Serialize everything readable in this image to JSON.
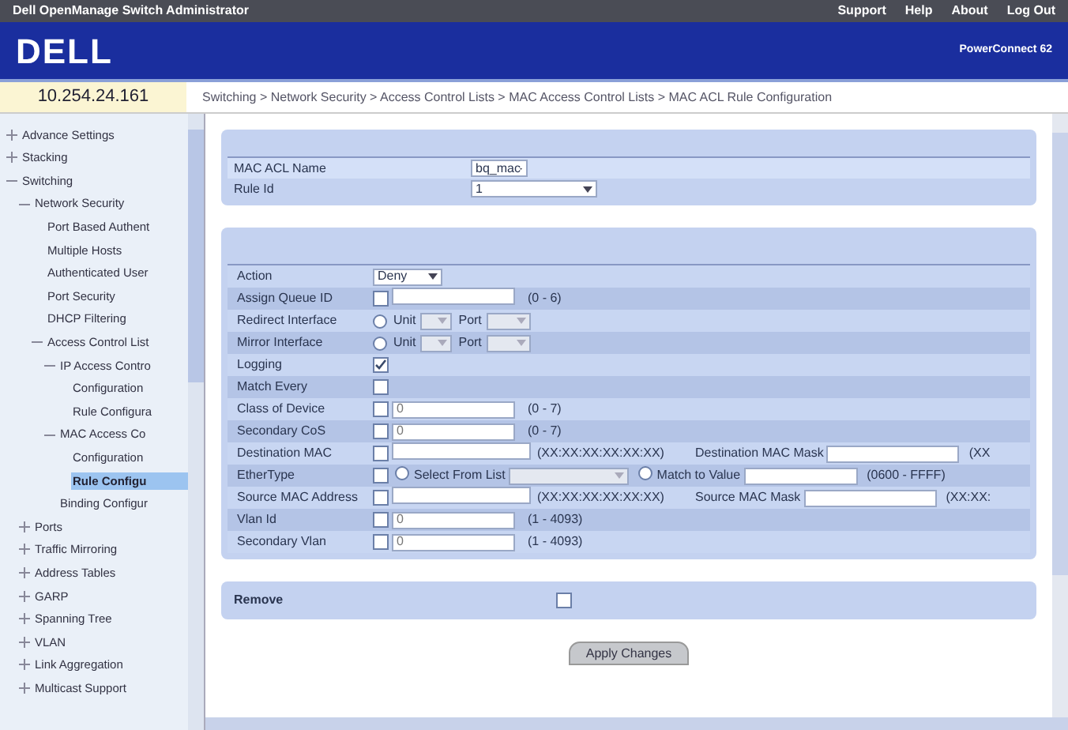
{
  "window": {
    "title": "Dell OpenManage Switch Administrator",
    "links": [
      "Support",
      "Help",
      "About",
      "Log Out"
    ]
  },
  "header": {
    "logo": "DELL",
    "product": "PowerConnect 62"
  },
  "address": "10.254.24.161",
  "breadcrumb": "Switching > Network Security > Access Control Lists > MAC Access Control Lists > MAC ACL Rule Configuration",
  "sidebar": {
    "items": [
      {
        "label": "Advance Settings",
        "expanded": false,
        "selected": false
      },
      {
        "label": "Stacking",
        "expanded": false,
        "selected": false
      },
      {
        "label": "Switching",
        "expanded": true,
        "selected": false,
        "children": [
          {
            "label": "Network Security",
            "expanded": true,
            "selected": false,
            "children": [
              {
                "label": "Port Based Authent",
                "selected": false
              },
              {
                "label": "Multiple Hosts",
                "selected": false
              },
              {
                "label": "Authenticated User",
                "selected": false
              },
              {
                "label": "Port Security",
                "selected": false
              },
              {
                "label": "DHCP Filtering",
                "selected": false
              },
              {
                "label": "Access Control List",
                "expanded": true,
                "selected": false,
                "children": [
                  {
                    "label": "IP Access Contro",
                    "expanded": true,
                    "selected": false,
                    "children": [
                      {
                        "label": "Configuration",
                        "selected": false
                      },
                      {
                        "label": "Rule Configura",
                        "selected": false
                      }
                    ]
                  },
                  {
                    "label": "MAC Access Co",
                    "expanded": true,
                    "selected": false,
                    "children": [
                      {
                        "label": "Configuration",
                        "selected": false
                      },
                      {
                        "label": "Rule Configu",
                        "selected": true
                      }
                    ]
                  },
                  {
                    "label": "Binding Configur",
                    "selected": false
                  }
                ]
              }
            ]
          },
          {
            "label": "Ports",
            "expanded": false,
            "selected": false
          },
          {
            "label": "Traffic Mirroring",
            "expanded": false,
            "selected": false
          },
          {
            "label": "Address Tables",
            "expanded": false,
            "selected": false
          },
          {
            "label": "GARP",
            "expanded": false,
            "selected": false
          },
          {
            "label": "Spanning Tree",
            "expanded": false,
            "selected": false
          },
          {
            "label": "VLAN",
            "expanded": false,
            "selected": false
          },
          {
            "label": "Link Aggregation",
            "expanded": false,
            "selected": false
          },
          {
            "label": "Multicast Support",
            "expanded": false,
            "selected": false
          }
        ]
      }
    ]
  },
  "acl": {
    "name_label": "MAC ACL Name",
    "name_value": "bq_mac",
    "rule_label": "Rule Id",
    "rule_value": "1"
  },
  "rules": [
    {
      "kind": "select",
      "label": "Action",
      "value": "Deny"
    },
    {
      "kind": "check_field",
      "label": "Assign Queue ID",
      "checked": false,
      "range": "(0 - 6)"
    },
    {
      "kind": "interface",
      "label": "Redirect Interface",
      "selected": false,
      "unit_label": "Unit",
      "port_label": "Port"
    },
    {
      "kind": "interface",
      "label": "Mirror Interface",
      "selected": false,
      "unit_label": "Unit",
      "port_label": "Port"
    },
    {
      "kind": "check",
      "label": "Logging",
      "checked": true
    },
    {
      "kind": "check",
      "label": "Match Every",
      "checked": false
    },
    {
      "kind": "check_field",
      "label": "Class of Device",
      "checked": false,
      "value": "0",
      "range": "(0 - 7)"
    },
    {
      "kind": "check_field",
      "label": "Secondary CoS",
      "checked": false,
      "value": "0",
      "range": "(0 - 7)"
    },
    {
      "kind": "mac",
      "label": "Destination MAC",
      "checked": false,
      "format": "(XX:XX:XX:XX:XX:XX)",
      "mask_label": "Destination MAC Mask",
      "mask_format": "(XX"
    },
    {
      "kind": "ethertype",
      "label": "EtherType",
      "checked": false,
      "list_label": "Select From List",
      "list_selected": false,
      "value_label": "Match to Value",
      "value_selected": false,
      "range": "(0600 - FFFF)"
    },
    {
      "kind": "mac",
      "label": "Source MAC Address",
      "checked": false,
      "format": "(XX:XX:XX:XX:XX:XX)",
      "mask_label": "Source MAC Mask",
      "mask_format": "(XX:XX:"
    },
    {
      "kind": "check_field",
      "label": "Vlan Id",
      "checked": false,
      "value": "0",
      "range": "(1 - 4093)"
    },
    {
      "kind": "check_field",
      "label": "Secondary Vlan",
      "checked": false,
      "value": "0",
      "range": "(1 - 4093)"
    }
  ],
  "remove": {
    "label": "Remove",
    "checked": false
  },
  "apply_button": "Apply Changes"
}
